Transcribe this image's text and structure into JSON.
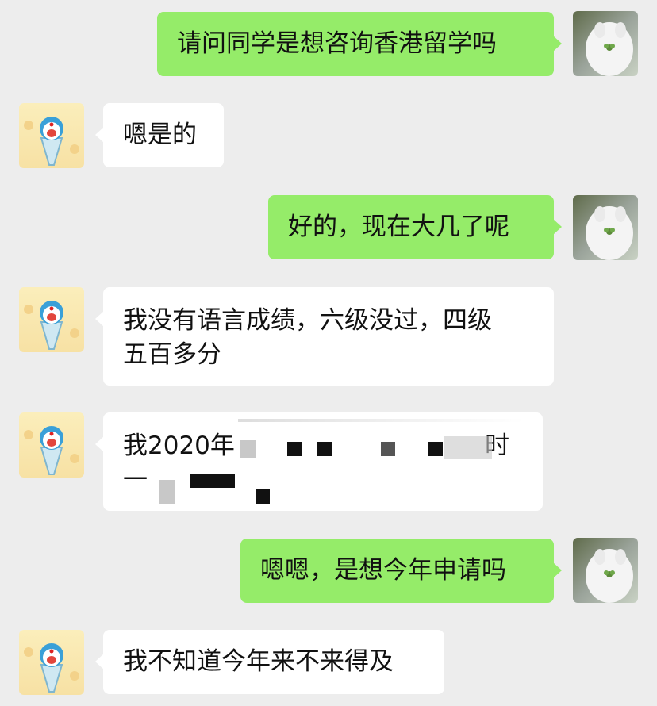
{
  "messages": [
    {
      "side": "me",
      "text": "请问同学是想咨询香港留学吗"
    },
    {
      "side": "them",
      "text": "嗯是的"
    },
    {
      "side": "me",
      "text": "好的，现在大几了呢"
    },
    {
      "side": "them",
      "text": "我没有语言成绩，六级没过，四级五百多分",
      "lines": [
        "我没有语言成绩，六级没过，四级",
        "五百多分"
      ]
    },
    {
      "side": "them",
      "text_visible_line1_prefix": "我2020年",
      "text_visible_line1_suffix": "时",
      "text_visible_line2_prefix": "一",
      "redacted": true
    },
    {
      "side": "me",
      "text": "嗯嗯，是想今年申请吗"
    },
    {
      "side": "them",
      "text": "我不知道今年来不来得及"
    }
  ],
  "avatars": {
    "me": "white-cat-avatar",
    "them": "doraemon-avatar"
  },
  "colors": {
    "background": "#ededed",
    "my_bubble": "#95ec69",
    "their_bubble": "#ffffff"
  }
}
